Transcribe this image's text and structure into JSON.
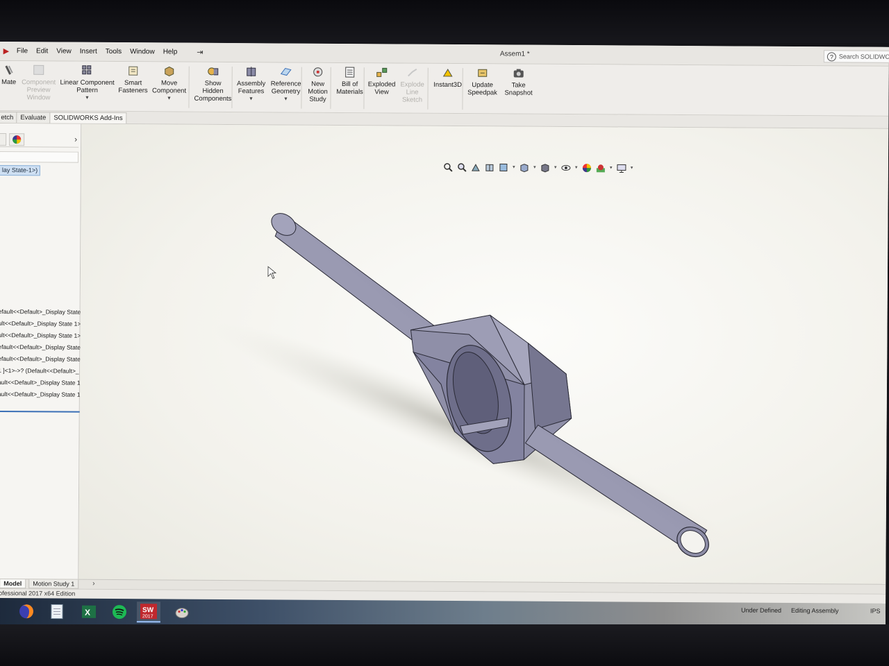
{
  "window": {
    "title": "Assem1 *",
    "search_placeholder": "Search SOLIDWO"
  },
  "menu": [
    "File",
    "Edit",
    "View",
    "Insert",
    "Tools",
    "Window",
    "Help"
  ],
  "commands": [
    {
      "id": "mate",
      "label": [
        "Mate"
      ],
      "icon": "mate-icon",
      "disabled": false,
      "dropdown": false
    },
    {
      "id": "component-preview-window",
      "label": [
        "Component",
        "Preview",
        "Window"
      ],
      "icon": "preview-window-icon",
      "disabled": true,
      "dropdown": false
    },
    {
      "id": "linear-component-pattern",
      "label": [
        "Linear Component",
        "Pattern"
      ],
      "icon": "pattern-icon",
      "disabled": false,
      "dropdown": true
    },
    {
      "id": "smart-fasteners",
      "label": [
        "Smart",
        "Fasteners"
      ],
      "icon": "fastener-icon",
      "disabled": false,
      "dropdown": false
    },
    {
      "id": "move-component",
      "label": [
        "Move",
        "Component"
      ],
      "icon": "move-component-icon",
      "disabled": false,
      "dropdown": true
    },
    {
      "id": "show-hidden-components",
      "label": [
        "Show",
        "Hidden",
        "Components"
      ],
      "icon": "show-hidden-icon",
      "disabled": false,
      "dropdown": false
    },
    {
      "id": "assembly-features",
      "label": [
        "Assembly",
        "Features"
      ],
      "icon": "assembly-features-icon",
      "disabled": false,
      "dropdown": true
    },
    {
      "id": "reference-geometry",
      "label": [
        "Reference",
        "Geometry"
      ],
      "icon": "reference-geometry-icon",
      "disabled": false,
      "dropdown": true
    },
    {
      "id": "new-motion-study",
      "label": [
        "New",
        "Motion",
        "Study"
      ],
      "icon": "motion-study-icon",
      "disabled": false,
      "dropdown": false
    },
    {
      "id": "bill-of-materials",
      "label": [
        "Bill of",
        "Materials"
      ],
      "icon": "bom-icon",
      "disabled": false,
      "dropdown": false
    },
    {
      "id": "exploded-view",
      "label": [
        "Exploded",
        "View"
      ],
      "icon": "exploded-view-icon",
      "disabled": false,
      "dropdown": false
    },
    {
      "id": "explode-line-sketch",
      "label": [
        "Explode",
        "Line",
        "Sketch"
      ],
      "icon": "explode-line-icon",
      "disabled": true,
      "dropdown": false
    },
    {
      "id": "instant3d",
      "label": [
        "Instant3D"
      ],
      "icon": "instant3d-icon",
      "disabled": false,
      "dropdown": false
    },
    {
      "id": "update-speedpak",
      "label": [
        "Update",
        "Speedpak"
      ],
      "icon": "speedpak-icon",
      "disabled": false,
      "dropdown": false
    },
    {
      "id": "take-snapshot",
      "label": [
        "Take",
        "Snapshot"
      ],
      "icon": "camera-icon",
      "disabled": false,
      "dropdown": false
    }
  ],
  "tabs": [
    "etch",
    "Evaluate",
    "SOLIDWORKS Add-Ins"
  ],
  "tree": {
    "root": "lay State-1>)",
    "rows": [
      "efault<<Default>_Display State",
      "ult<<Default>_Display State 1>",
      "ult<<Default>_Display State 1>",
      "efault<<Default>_Display State",
      "efault<<Default>_Display State",
      "1 ]<1>->? (Default<<Default>_",
      "ault<<Default>_Display State 1>",
      "ault<<Default>_Display State 1>"
    ]
  },
  "model_tabs": [
    "Model",
    "Motion Study 1"
  ],
  "status": {
    "edition": "rofessional 2017 x64 Edition",
    "under_defined": "Under Defined",
    "editing": "Editing Assembly",
    "units": "IPS"
  },
  "taskbar": [
    {
      "id": "firefox",
      "icon": "firefox-icon"
    },
    {
      "id": "files",
      "icon": "file-icon"
    },
    {
      "id": "excel",
      "icon": "excel-icon"
    },
    {
      "id": "spotify",
      "icon": "spotify-icon"
    },
    {
      "id": "solidworks",
      "icon": "solidworks-icon",
      "label": "2017"
    },
    {
      "id": "paint",
      "icon": "paint-icon"
    }
  ],
  "colors": {
    "model_fill": "#8c8ca6",
    "model_dark": "#5d5d78",
    "model_light": "#a9a9c0",
    "selection": "#cfe0f3",
    "accent_red": "#c0282d"
  }
}
